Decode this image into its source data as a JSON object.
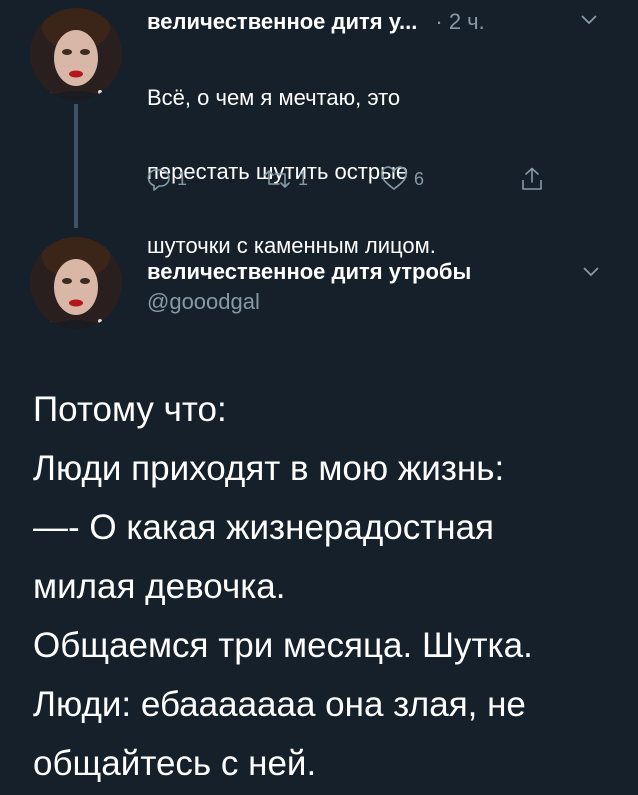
{
  "reply_tweet": {
    "author_name": "величественное дитя у...",
    "time": "· 2 ч.",
    "text_lines": [
      "Всё, о чем я мечтаю, это",
      "перестать шутить острые",
      "шуточки с каменным лицом."
    ],
    "actions": {
      "replies": "1",
      "retweets": "1",
      "likes": "6"
    },
    "icons": {
      "reply": "reply-icon",
      "retweet": "retweet-icon",
      "like": "heart-icon",
      "share": "share-icon",
      "menu": "chevron-down-icon"
    }
  },
  "main_tweet": {
    "author_name": "величественное дитя утробы",
    "handle": "@gooodgal",
    "text_lines": [
      "Потому что:",
      "Люди приходят в мою жизнь:",
      "—- О какая жизнерадостная",
      "милая девочка.",
      "Общаемся три месяца. Шутка.",
      "Люди: ебааааааа она злая, не",
      "общайтесь с ней."
    ]
  },
  "colors": {
    "background": "#15202b",
    "secondary_text": "#8899a6",
    "thread_line": "#3d5466"
  }
}
